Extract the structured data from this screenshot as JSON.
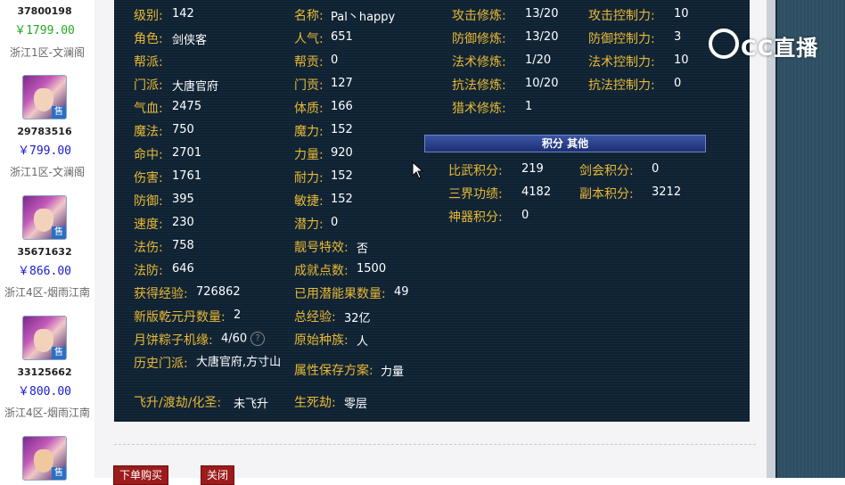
{
  "listings": [
    {
      "id": "37800198",
      "price": "￥1799.00",
      "server": "浙江1区-文澜阁"
    },
    {
      "id": "29783516",
      "price": "￥799.00",
      "server": "浙江1区-文澜阁"
    },
    {
      "id": "35671632",
      "price": "￥866.00",
      "server": "浙江4区-烟雨江南"
    },
    {
      "id": "33125662",
      "price": "￥800.00",
      "server": "浙江4区-烟雨江南"
    }
  ],
  "sale_tag": "售",
  "col1": [
    {
      "label": "级别:",
      "value": "142"
    },
    {
      "label": "角色:",
      "value": "剑侠客"
    },
    {
      "label": "帮派:",
      "value": ""
    },
    {
      "label": "门派:",
      "value": "大唐官府"
    },
    {
      "label": "气血:",
      "value": "2475"
    },
    {
      "label": "魔法:",
      "value": "750"
    },
    {
      "label": "命中:",
      "value": "2701"
    },
    {
      "label": "伤害:",
      "value": "1761"
    },
    {
      "label": "防御:",
      "value": "395"
    },
    {
      "label": "速度:",
      "value": "230"
    },
    {
      "label": "法伤:",
      "value": "758"
    },
    {
      "label": "法防:",
      "value": "646"
    },
    {
      "label": "获得经验:",
      "value": "726862"
    },
    {
      "label": "新版乾元丹数量:",
      "value": "2"
    },
    {
      "label": "月饼粽子机缘:",
      "value": "4/60"
    },
    {
      "label": "历史门派:",
      "value": "大唐官府,方寸山"
    },
    {
      "label": "飞升/渡劫/化圣:",
      "value": "未飞升"
    }
  ],
  "col2": [
    {
      "label": "名称:",
      "value": "Pal丶happy"
    },
    {
      "label": "人气:",
      "value": "651"
    },
    {
      "label": "帮贡:",
      "value": "0"
    },
    {
      "label": "门贡:",
      "value": "127"
    },
    {
      "label": "体质:",
      "value": "166"
    },
    {
      "label": "魔力:",
      "value": "152"
    },
    {
      "label": "力量:",
      "value": "920"
    },
    {
      "label": "耐力:",
      "value": "152"
    },
    {
      "label": "敏捷:",
      "value": "152"
    },
    {
      "label": "潜力:",
      "value": "0"
    },
    {
      "label": "靓号特效:",
      "value": "否"
    },
    {
      "label": "成就点数:",
      "value": "1500"
    },
    {
      "label": "已用潜能果数量:",
      "value": "49"
    },
    {
      "label": "总经验:",
      "value": "32亿"
    },
    {
      "label": "原始种族:",
      "value": "人"
    },
    {
      "label": "属性保存方案:",
      "value": "力量"
    },
    {
      "label": "生死劫:",
      "value": "零层"
    }
  ],
  "col3": [
    {
      "label": "攻击修炼:",
      "value": "13/20"
    },
    {
      "label": "防御修炼:",
      "value": "13/20"
    },
    {
      "label": "法术修炼:",
      "value": "1/20"
    },
    {
      "label": "抗法修炼:",
      "value": "10/20"
    },
    {
      "label": "猎术修炼:",
      "value": "1"
    }
  ],
  "col4": [
    {
      "label": "攻击控制力:",
      "value": "10"
    },
    {
      "label": "防御控制力:",
      "value": "3"
    },
    {
      "label": "法术控制力:",
      "value": "10"
    },
    {
      "label": "抗法控制力:",
      "value": "0"
    }
  ],
  "score_header": "积分 其他",
  "scores": [
    {
      "label": "比武积分:",
      "value": "219"
    },
    {
      "label": "剑会积分:",
      "value": "0"
    },
    {
      "label": "三界功绩:",
      "value": "4182"
    },
    {
      "label": "副本积分:",
      "value": "3212"
    },
    {
      "label": "神器积分:",
      "value": "0"
    }
  ],
  "buttons": {
    "buy": "下单购买",
    "close": "关闭"
  },
  "watermark": "CC直播",
  "help_icon": "?"
}
